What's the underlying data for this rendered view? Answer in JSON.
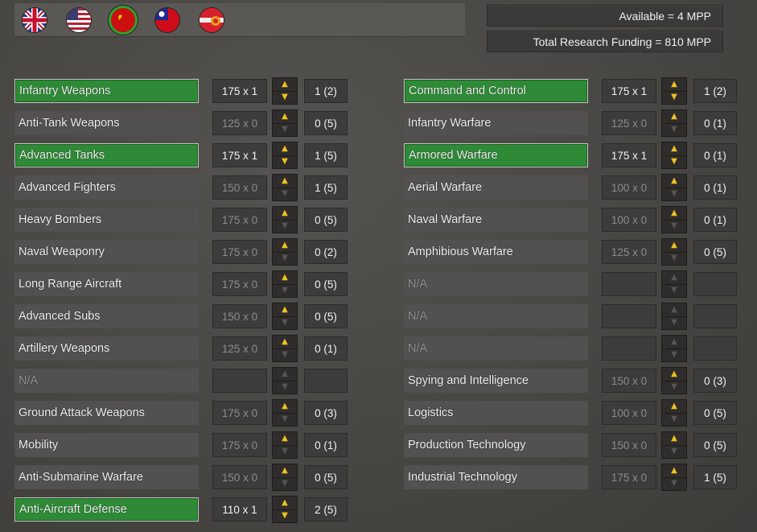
{
  "header": {
    "available": "Available = 4 MPP",
    "funding": "Total Research Funding = 810 MPP"
  },
  "flags": [
    {
      "name": "uk-flag-icon",
      "active": false
    },
    {
      "name": "usa-flag-icon",
      "active": false
    },
    {
      "name": "ussr-flag-icon",
      "active": true
    },
    {
      "name": "china-flag-icon",
      "active": false
    },
    {
      "name": "other-flag-icon",
      "active": false
    }
  ],
  "left": [
    {
      "name": "Infantry Weapons",
      "cost": "175 x 1",
      "level": "1 (2)",
      "active": true
    },
    {
      "name": "Anti-Tank Weapons",
      "cost": "125 x 0",
      "level": "0 (5)",
      "active": false
    },
    {
      "name": "Advanced Tanks",
      "cost": "175 x 1",
      "level": "1 (5)",
      "active": true
    },
    {
      "name": "Advanced Fighters",
      "cost": "150 x 0",
      "level": "1 (5)",
      "active": false
    },
    {
      "name": "Heavy Bombers",
      "cost": "175 x 0",
      "level": "0 (5)",
      "active": false
    },
    {
      "name": "Naval Weaponry",
      "cost": "175 x 0",
      "level": "0 (2)",
      "active": false
    },
    {
      "name": "Long Range Aircraft",
      "cost": "175 x 0",
      "level": "0 (5)",
      "active": false
    },
    {
      "name": "Advanced Subs",
      "cost": "150 x 0",
      "level": "0 (5)",
      "active": false
    },
    {
      "name": "Artillery Weapons",
      "cost": "125 x 0",
      "level": "0 (1)",
      "active": false
    },
    {
      "name": "N/A",
      "cost": "",
      "level": "",
      "active": false,
      "na": true
    },
    {
      "name": "Ground Attack Weapons",
      "cost": "175 x 0",
      "level": "0 (3)",
      "active": false
    },
    {
      "name": "Mobility",
      "cost": "175 x 0",
      "level": "0 (1)",
      "active": false
    },
    {
      "name": "Anti-Submarine Warfare",
      "cost": "150 x 0",
      "level": "0 (5)",
      "active": false
    },
    {
      "name": "Anti-Aircraft Defense",
      "cost": "110 x 1",
      "level": "2 (5)",
      "active": true
    }
  ],
  "right": [
    {
      "name": "Command and Control",
      "cost": "175 x 1",
      "level": "1 (2)",
      "active": true
    },
    {
      "name": "Infantry Warfare",
      "cost": "125 x 0",
      "level": "0 (1)",
      "active": false
    },
    {
      "name": "Armored Warfare",
      "cost": "175 x 1",
      "level": "0 (1)",
      "active": true
    },
    {
      "name": "Aerial Warfare",
      "cost": "100 x 0",
      "level": "0 (1)",
      "active": false
    },
    {
      "name": "Naval Warfare",
      "cost": "100 x 0",
      "level": "0 (1)",
      "active": false
    },
    {
      "name": "Amphibious Warfare",
      "cost": "125 x 0",
      "level": "0 (5)",
      "active": false
    },
    {
      "name": "N/A",
      "cost": "",
      "level": "",
      "active": false,
      "na": true
    },
    {
      "name": "N/A",
      "cost": "",
      "level": "",
      "active": false,
      "na": true
    },
    {
      "name": "N/A",
      "cost": "",
      "level": "",
      "active": false,
      "na": true
    },
    {
      "name": "Spying and Intelligence",
      "cost": "150 x 0",
      "level": "0 (3)",
      "active": false
    },
    {
      "name": "Logistics",
      "cost": "100 x 0",
      "level": "0 (5)",
      "active": false
    },
    {
      "name": "Production Technology",
      "cost": "150 x 0",
      "level": "0 (5)",
      "active": false
    },
    {
      "name": "Industrial Technology",
      "cost": "175 x 0",
      "level": "1 (5)",
      "active": false
    }
  ]
}
